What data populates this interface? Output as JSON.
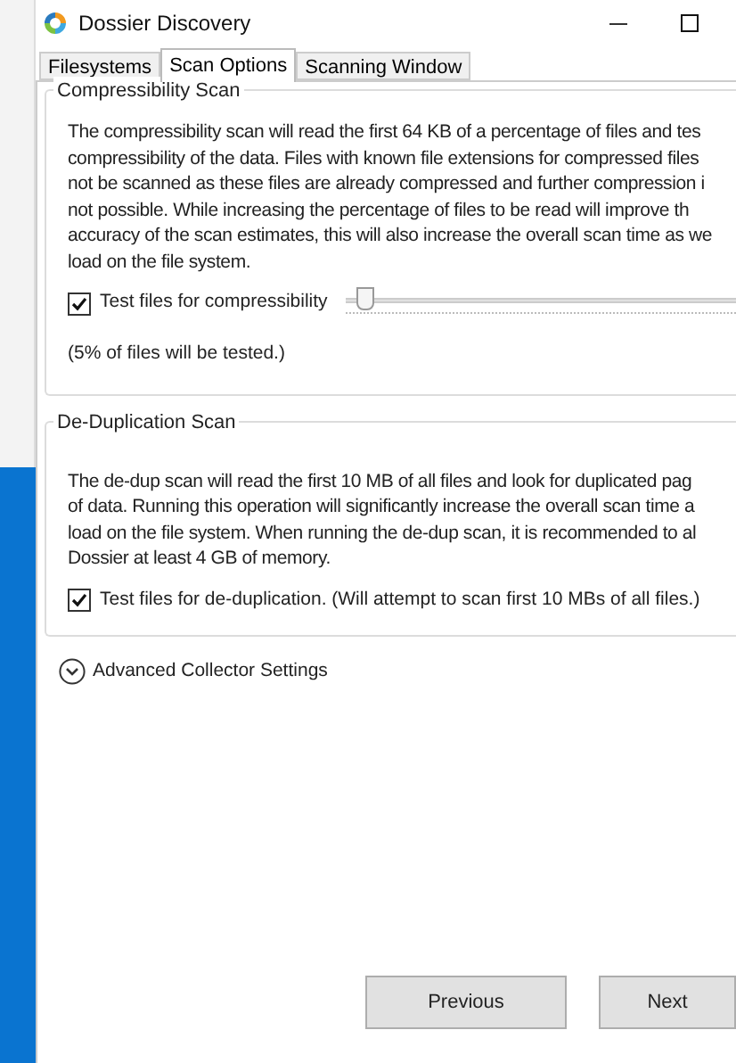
{
  "window": {
    "title": "Dossier Discovery"
  },
  "tabs": [
    {
      "label": "Filesystems",
      "selected": false
    },
    {
      "label": "Scan Options",
      "selected": true
    },
    {
      "label": "Scanning Window",
      "selected": false
    }
  ],
  "compressibility_scan": {
    "title": "Compressibility Scan",
    "description_lines": [
      "The compressibility scan will read the first 64 KB of a percentage of files and tes",
      "compressibility of the data. Files with known file extensions for compressed files",
      "not be scanned as these files are already compressed and further compression i",
      "not possible. While increasing the percentage of files to be read will improve th",
      "accuracy of the scan estimates, this will also increase the overall scan time as we",
      "load on the file system."
    ],
    "checkbox": {
      "label": "Test files for compressibility",
      "checked": true
    },
    "slider": {
      "level": 0.02
    },
    "note": "(5% of files will be tested.)"
  },
  "deduplication_scan": {
    "title": "De-Duplication Scan",
    "description_lines": [
      "The de-dup scan will read the first 10 MB of all files and look for duplicated pag",
      "of data. Running this operation will significantly increase the overall scan time a",
      "load on the file system. When running the de-dup scan, it is recommended to al",
      "Dossier at least 4 GB of memory."
    ],
    "checkbox": {
      "label": "Test files for de-duplication.  (Will attempt to scan first 10 MBs of all files.)",
      "checked": true
    }
  },
  "advanced": {
    "label": "Advanced Collector Settings",
    "expanded": false
  },
  "buttons": [
    "Previous",
    "Next"
  ]
}
